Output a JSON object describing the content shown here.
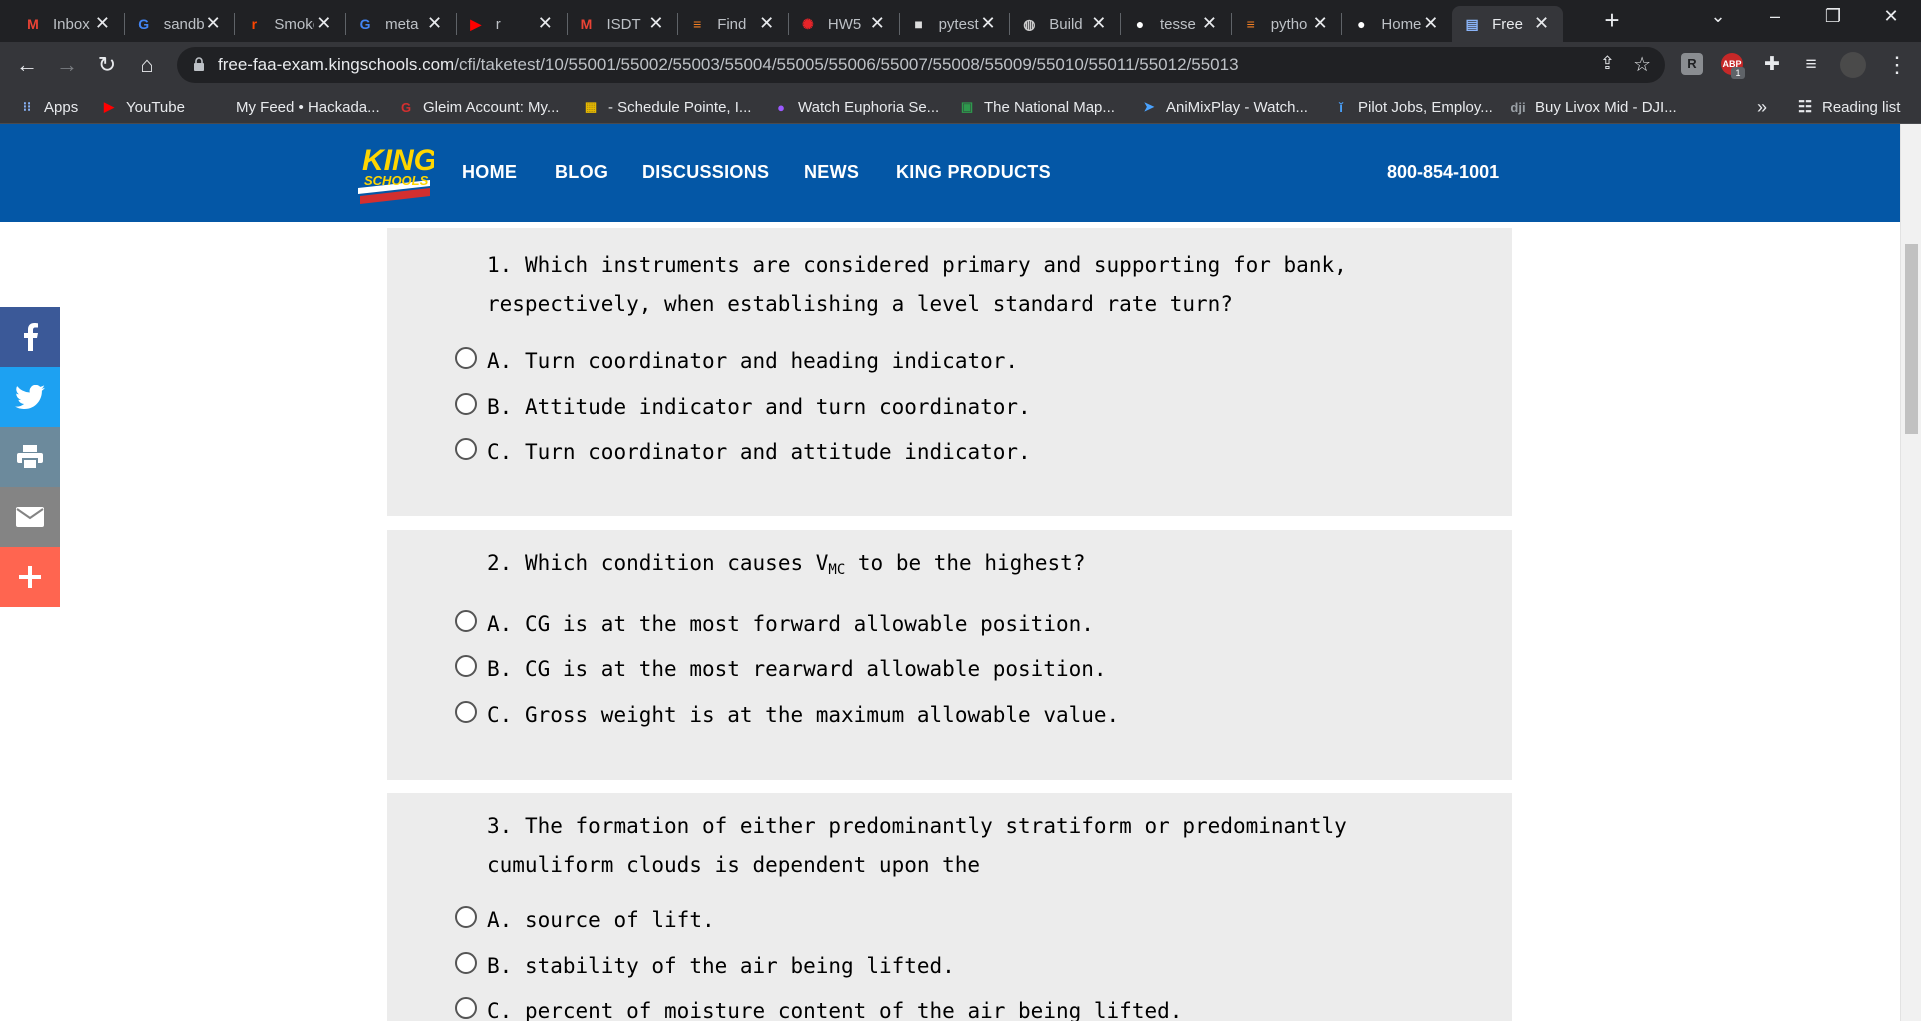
{
  "browser": {
    "tabs": [
      {
        "label": "Inbox",
        "icon": "gmail-icon",
        "fav": "M",
        "color": "#ea4335"
      },
      {
        "label": "sandbox",
        "icon": "google-icon",
        "fav": "G",
        "color": "#4285f4"
      },
      {
        "label": "Smoke",
        "icon": "reddit-icon",
        "fav": "r",
        "color": "#ff4500"
      },
      {
        "label": "meta",
        "icon": "google-icon",
        "fav": "G",
        "color": "#4285f4"
      },
      {
        "label": "r",
        "icon": "youtube-icon",
        "fav": "▶",
        "color": "#ff0000"
      },
      {
        "label": "ISDT",
        "icon": "gmail-icon",
        "fav": "M",
        "color": "#ea4335"
      },
      {
        "label": "Find",
        "icon": "stackoverflow-icon",
        "fav": "≡",
        "color": "#f48024"
      },
      {
        "label": "HW5",
        "icon": "canvas-icon",
        "fav": "✺",
        "color": "#e72429"
      },
      {
        "label": "pytest",
        "icon": "package-icon",
        "fav": "■",
        "color": "#dddddd"
      },
      {
        "label": "Build",
        "icon": "globe-icon",
        "fav": "◍",
        "color": "#cccccc"
      },
      {
        "label": "tesse",
        "icon": "github-icon",
        "fav": "●",
        "color": "#ffffff"
      },
      {
        "label": "pytho",
        "icon": "stackoverflow-icon",
        "fav": "≡",
        "color": "#f48024"
      },
      {
        "label": "Home",
        "icon": "github-icon",
        "fav": "●",
        "color": "#ffffff"
      },
      {
        "label": "Free",
        "icon": "page-icon",
        "fav": "▤",
        "color": "#8ab4f8",
        "active": true
      }
    ],
    "url_host": "free-faa-exam.kingschools.com",
    "url_path": "/cfi/taketest/10/55001/55002/55003/55004/55005/55006/55007/55008/55009/55010/55011/55012/55013",
    "bookmarks": [
      {
        "label": "Apps",
        "icon": "apps-grid-icon"
      },
      {
        "label": "YouTube",
        "icon": "youtube-icon"
      },
      {
        "label": "My Feed • Hackada...",
        "icon": "hackaday-icon"
      },
      {
        "label": "Gleim Account: My...",
        "icon": "gleim-icon"
      },
      {
        "label": "- Schedule Pointe, I...",
        "icon": "schedule-icon"
      },
      {
        "label": "Watch Euphoria Se...",
        "icon": "euphoria-icon"
      },
      {
        "label": "The National Map...",
        "icon": "nationalmap-icon"
      },
      {
        "label": "AniMixPlay - Watch...",
        "icon": "animixplay-icon"
      },
      {
        "label": "Pilot Jobs, Employ...",
        "icon": "pilotjobs-icon"
      },
      {
        "label": "Buy Livox Mid - DJI...",
        "icon": "dji-icon"
      }
    ],
    "more_bookmarks": "»",
    "reading_list": "Reading list",
    "extension_badge": "1"
  },
  "site": {
    "logo_line1": "KING",
    "logo_line2": "SCHOOLS",
    "nav": [
      "HOME",
      "BLOG",
      "DISCUSSIONS",
      "NEWS",
      "KING PRODUCTS"
    ],
    "phone": "800-854-1001",
    "brand_color": "#0457a6"
  },
  "questions": [
    {
      "number": "1.",
      "text_line1": "Which instruments are considered primary and supporting for bank,",
      "text_line2": "respectively, when establishing a level standard rate turn?",
      "options": [
        {
          "letter": "A.",
          "text": "Turn coordinator and heading indicator."
        },
        {
          "letter": "B.",
          "text": "Attitude indicator and turn coordinator."
        },
        {
          "letter": "C.",
          "text": "Turn coordinator and attitude indicator."
        }
      ]
    },
    {
      "number": "2.",
      "text_pre": "Which condition causes V",
      "text_sub": "MC",
      "text_post": " to be the highest?",
      "options": [
        {
          "letter": "A.",
          "text": "CG is at the most forward allowable position."
        },
        {
          "letter": "B.",
          "text": "CG is at the most rearward allowable position."
        },
        {
          "letter": "C.",
          "text": "Gross weight is at the maximum allowable value."
        }
      ]
    },
    {
      "number": "3.",
      "text_line1": "The formation of either predominantly stratiform or predominantly",
      "text_line2": "cumuliform clouds is dependent upon the",
      "options": [
        {
          "letter": "A.",
          "text": "source of lift."
        },
        {
          "letter": "B.",
          "text": "stability of the air being lifted."
        },
        {
          "letter": "C.",
          "text": "percent of moisture content of the air being lifted."
        }
      ]
    }
  ],
  "social": [
    {
      "name": "facebook",
      "icon": "facebook-icon",
      "color": "#3b5998"
    },
    {
      "name": "twitter",
      "icon": "twitter-icon",
      "color": "#1da1f2"
    },
    {
      "name": "print",
      "icon": "printer-icon",
      "color": "#6c8a9c"
    },
    {
      "name": "email",
      "icon": "email-icon",
      "color": "#848484"
    },
    {
      "name": "more",
      "icon": "plus-icon",
      "color": "#ff6550"
    }
  ]
}
